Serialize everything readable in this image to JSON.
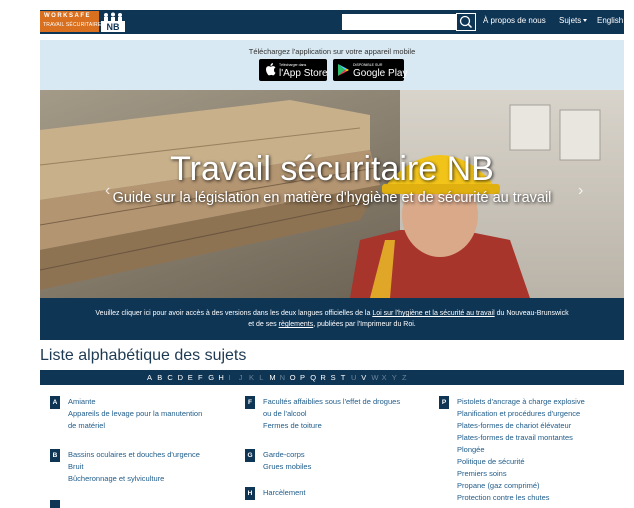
{
  "header": {
    "logo_worksafe": "WORKSAFE",
    "logo_travail": "TRAVAIL SÉCURITAIRE",
    "logo_nb": "NB",
    "search_placeholder": "",
    "nav": [
      {
        "label": "À propos de nous"
      },
      {
        "label": "Sujets"
      },
      {
        "label": "English"
      }
    ]
  },
  "app_banner": {
    "text": "Téléchargez l'application sur votre appareil mobile",
    "app_store_small": "Télécharger dans",
    "app_store_big": "l'App Store",
    "google_play_small": "DISPONIBLE SUR",
    "google_play_big": "Google Play"
  },
  "hero": {
    "title": "Travail sécuritaire NB",
    "subtitle": "Guide sur la législation en matière d'hygiène et de sécurité au travail",
    "prev": "‹",
    "next": "›"
  },
  "legal": {
    "text_1": "Veuillez cliquer ici pour avoir accès à des versions dans les deux langues officielles de la ",
    "link_1": "Loi sur l'hygiène et la sécurité au travail",
    "text_2": " du Nouveau-Brunswick",
    "text_3": "et de ses ",
    "link_2": "règlements",
    "text_4": ", publiées par l'Imprimeur du Roi."
  },
  "subjects": {
    "title": "Liste alphabétique des sujets",
    "letters": [
      "A",
      "B",
      "C",
      "D",
      "E",
      "F",
      "G",
      "H",
      "I",
      "J",
      "K",
      "L",
      "M",
      "N",
      "O",
      "P",
      "Q",
      "R",
      "S",
      "T",
      "U",
      "V",
      "W",
      "X",
      "Y",
      "Z"
    ],
    "disabled_letters": [
      "I",
      "J",
      "K",
      "L",
      "N",
      "U",
      "W",
      "X",
      "Y",
      "Z"
    ],
    "groups": [
      {
        "letter": "A",
        "items": [
          "Amiante",
          "Appareils de levage pour la manutention",
          "de matériel"
        ]
      },
      {
        "letter": "B",
        "items": [
          "Bassins oculaires et douches d'urgence",
          "Bruit",
          "Bûcheronnage et sylviculture"
        ]
      },
      {
        "letter": "F",
        "items": [
          "Facultés affaiblies sous l'effet de drogues",
          "ou de l'alcool",
          "Fermes de toiture"
        ]
      },
      {
        "letter": "G",
        "items": [
          "Garde-corps",
          "Grues mobiles"
        ]
      },
      {
        "letter": "H",
        "items": [
          "Harcèlement"
        ]
      },
      {
        "letter": "P",
        "items": [
          "Pistolets d'ancrage à charge explosive",
          "Planification et procédures d'urgence",
          "Plates-formes de chariot élévateur",
          "Plates-formes de travail montantes",
          "Plongée",
          "Politique de sécurité",
          "Premiers soins",
          "Propane (gaz comprimé)",
          "Protection contre les chutes"
        ]
      }
    ]
  },
  "colors": {
    "navy": "#0f3555",
    "banner_blue": "#d8e9f3",
    "orange": "#d8701f",
    "link": "#1f5c8a"
  }
}
